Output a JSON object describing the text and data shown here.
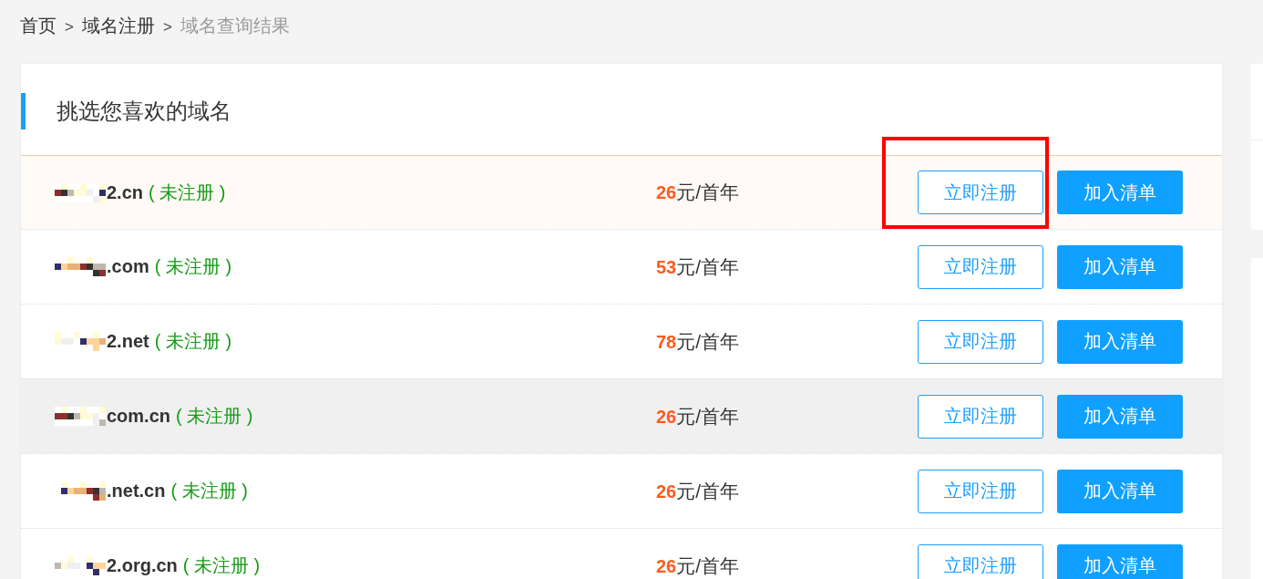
{
  "breadcrumb": {
    "items": [
      {
        "label": "首页",
        "current": false
      },
      {
        "label": "域名注册",
        "current": false
      },
      {
        "label": "域名查询结果",
        "current": true
      }
    ],
    "separators": [
      ">",
      ">"
    ]
  },
  "section": {
    "title": "挑选您喜欢的域名"
  },
  "rows": [
    {
      "domain": "2.cn",
      "status": "( 未注册 )",
      "price": "26",
      "unit": "元/首年",
      "register_label": "立即注册",
      "add_label": "加入清单",
      "highlighted": true,
      "shaded": false,
      "annotated": true
    },
    {
      "domain": ".com",
      "status": "( 未注册 )",
      "price": "53",
      "unit": "元/首年",
      "register_label": "立即注册",
      "add_label": "加入清单",
      "highlighted": false,
      "shaded": false,
      "annotated": false
    },
    {
      "domain": "2.net",
      "status": "( 未注册 )",
      "price": "78",
      "unit": "元/首年",
      "register_label": "立即注册",
      "add_label": "加入清单",
      "highlighted": false,
      "shaded": false,
      "annotated": false
    },
    {
      "domain": "com.cn",
      "status": "( 未注册 )",
      "price": "26",
      "unit": "元/首年",
      "register_label": "立即注册",
      "add_label": "加入清单",
      "highlighted": false,
      "shaded": true,
      "annotated": false
    },
    {
      "domain": ".net.cn",
      "status": "( 未注册 )",
      "price": "26",
      "unit": "元/首年",
      "register_label": "立即注册",
      "add_label": "加入清单",
      "highlighted": false,
      "shaded": false,
      "annotated": false
    },
    {
      "domain": "2.org.cn",
      "status": "( 未注册 )",
      "price": "26",
      "unit": "元/首年",
      "register_label": "立即注册",
      "add_label": "加入清单",
      "highlighted": false,
      "shaded": false,
      "annotated": false
    }
  ]
}
